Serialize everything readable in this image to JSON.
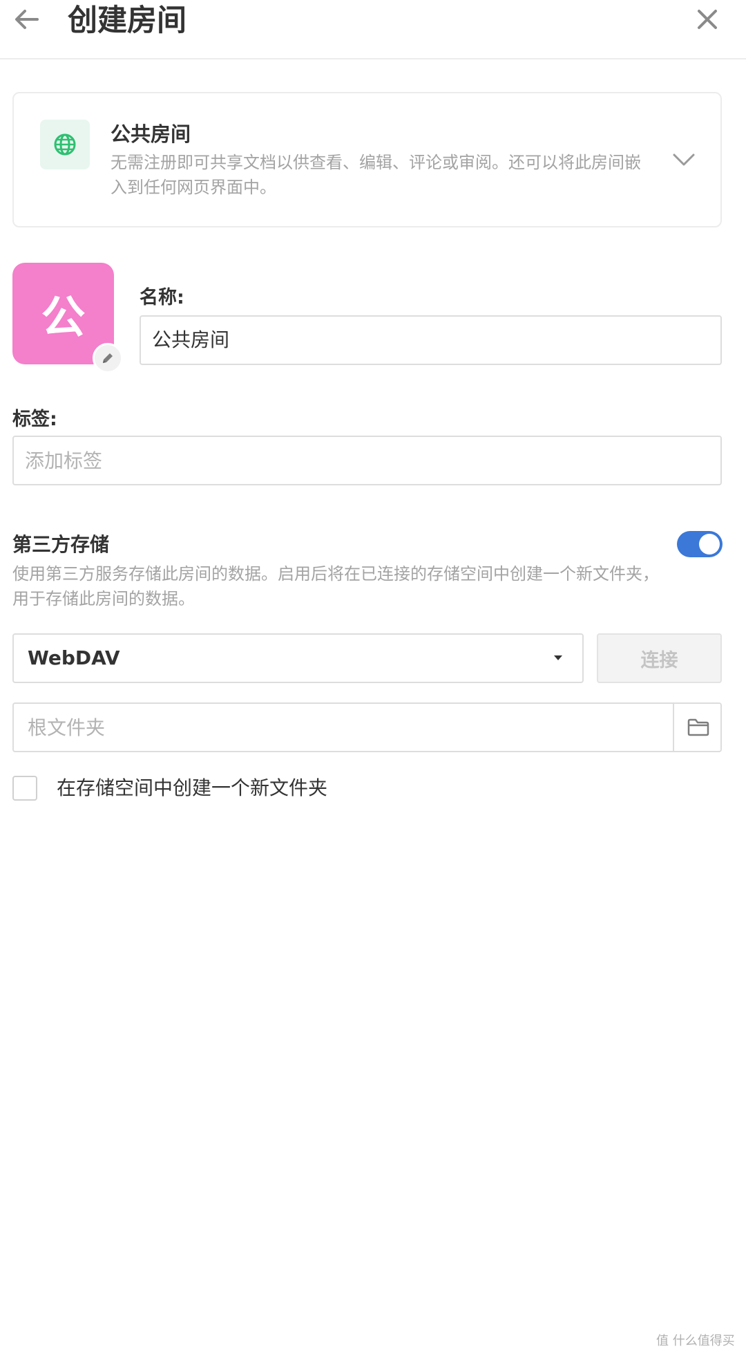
{
  "header": {
    "title": "创建房间"
  },
  "room_type": {
    "title": "公共房间",
    "description": "无需注册即可共享文档以供查看、编辑、评论或审阅。还可以将此房间嵌入到任何网页界面中。"
  },
  "avatar": {
    "letter": "公",
    "color": "#f47fcb"
  },
  "name_field": {
    "label": "名称:",
    "value": "公共房间"
  },
  "tags_field": {
    "label": "标签:",
    "placeholder": "添加标签"
  },
  "storage": {
    "title": "第三方存储",
    "enabled": true,
    "description": "使用第三方服务存储此房间的数据。启用后将在已连接的存储空间中创建一个新文件夹，用于存储此房间的数据。",
    "provider": "WebDAV",
    "connect_label": "连接",
    "folder_placeholder": "根文件夹",
    "create_folder_label": "在存储空间中创建一个新文件夹",
    "create_folder_checked": false
  },
  "colors": {
    "accent": "#3b78d8",
    "type_icon": "#2fbf71"
  },
  "watermark": {
    "text": "值 什么值得买"
  }
}
